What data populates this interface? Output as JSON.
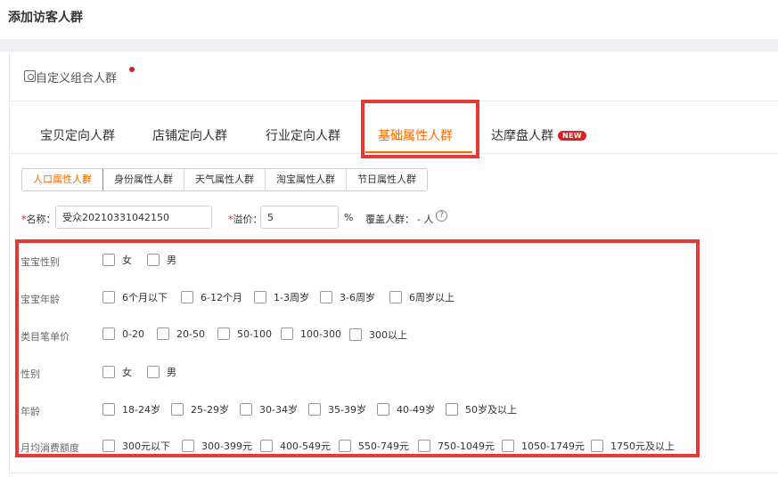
{
  "page": {
    "title": "添加访客人群"
  },
  "section": {
    "label": "自定义组合人群"
  },
  "tabs": [
    {
      "label": "宝贝定向人群"
    },
    {
      "label": "店铺定向人群"
    },
    {
      "label": "行业定向人群"
    },
    {
      "label": "基础属性人群"
    },
    {
      "label": "达摩盘人群"
    }
  ],
  "new_badge": "NEW",
  "subtabs": [
    {
      "label": "人口属性人群"
    },
    {
      "label": "身份属性人群"
    },
    {
      "label": "天气属性人群"
    },
    {
      "label": "淘宝属性人群"
    },
    {
      "label": "节日属性人群"
    }
  ],
  "form": {
    "required_mark": "*",
    "name_label": "名称：",
    "name_value": "受众20210331042150",
    "premium_label": "溢价：",
    "premium_value": "5",
    "percent": "%",
    "coverage_label": "覆盖人群：",
    "coverage_value": "- 人",
    "help_icon": "?"
  },
  "attributes": [
    {
      "label": "宝宝性别",
      "options": [
        "女",
        "男"
      ]
    },
    {
      "label": "宝宝年龄",
      "options": [
        "6个月以下",
        "6-12个月",
        "1-3周岁",
        "3-6周岁",
        "6周岁以上"
      ]
    },
    {
      "label": "类目笔单价",
      "options": [
        "0-20",
        "20-50",
        "50-100",
        "100-300",
        "300以上"
      ]
    },
    {
      "label": "性别",
      "options": [
        "女",
        "男"
      ]
    },
    {
      "label": "年龄",
      "options": [
        "18-24岁",
        "25-29岁",
        "30-34岁",
        "35-39岁",
        "40-49岁",
        "50岁及以上"
      ]
    },
    {
      "label": "月均消费额度",
      "options": [
        "300元以下",
        "300-399元",
        "400-549元",
        "550-749元",
        "750-1049元",
        "1050-1749元",
        "1750元及以上"
      ]
    }
  ],
  "colors": {
    "accent": "#ff6a00",
    "highlight": "#e53935",
    "badge": "#e02020"
  }
}
